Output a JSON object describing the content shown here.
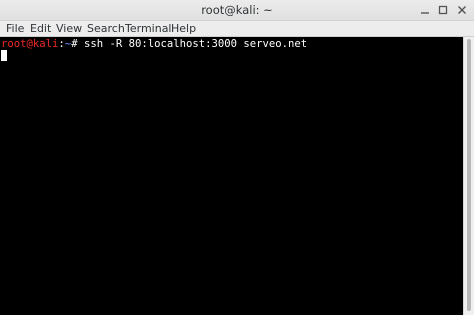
{
  "window": {
    "title": "root@kali: ~"
  },
  "menu": {
    "items": [
      "File",
      "Edit",
      "View",
      "Search",
      "Terminal",
      "Help"
    ]
  },
  "terminal": {
    "prompt_user": "root@kali",
    "prompt_sep": ":",
    "prompt_path": "~",
    "prompt_symbol": "#",
    "command": " ssh -R 80:localhost:3000 serveo.net"
  },
  "icons": {
    "minimize": "minimize-icon",
    "maximize": "maximize-icon",
    "close": "close-icon"
  },
  "colors": {
    "terminal_bg": "#000000",
    "prompt_user": "#ef2929",
    "prompt_path": "#6f8fff",
    "text": "#ffffff"
  }
}
